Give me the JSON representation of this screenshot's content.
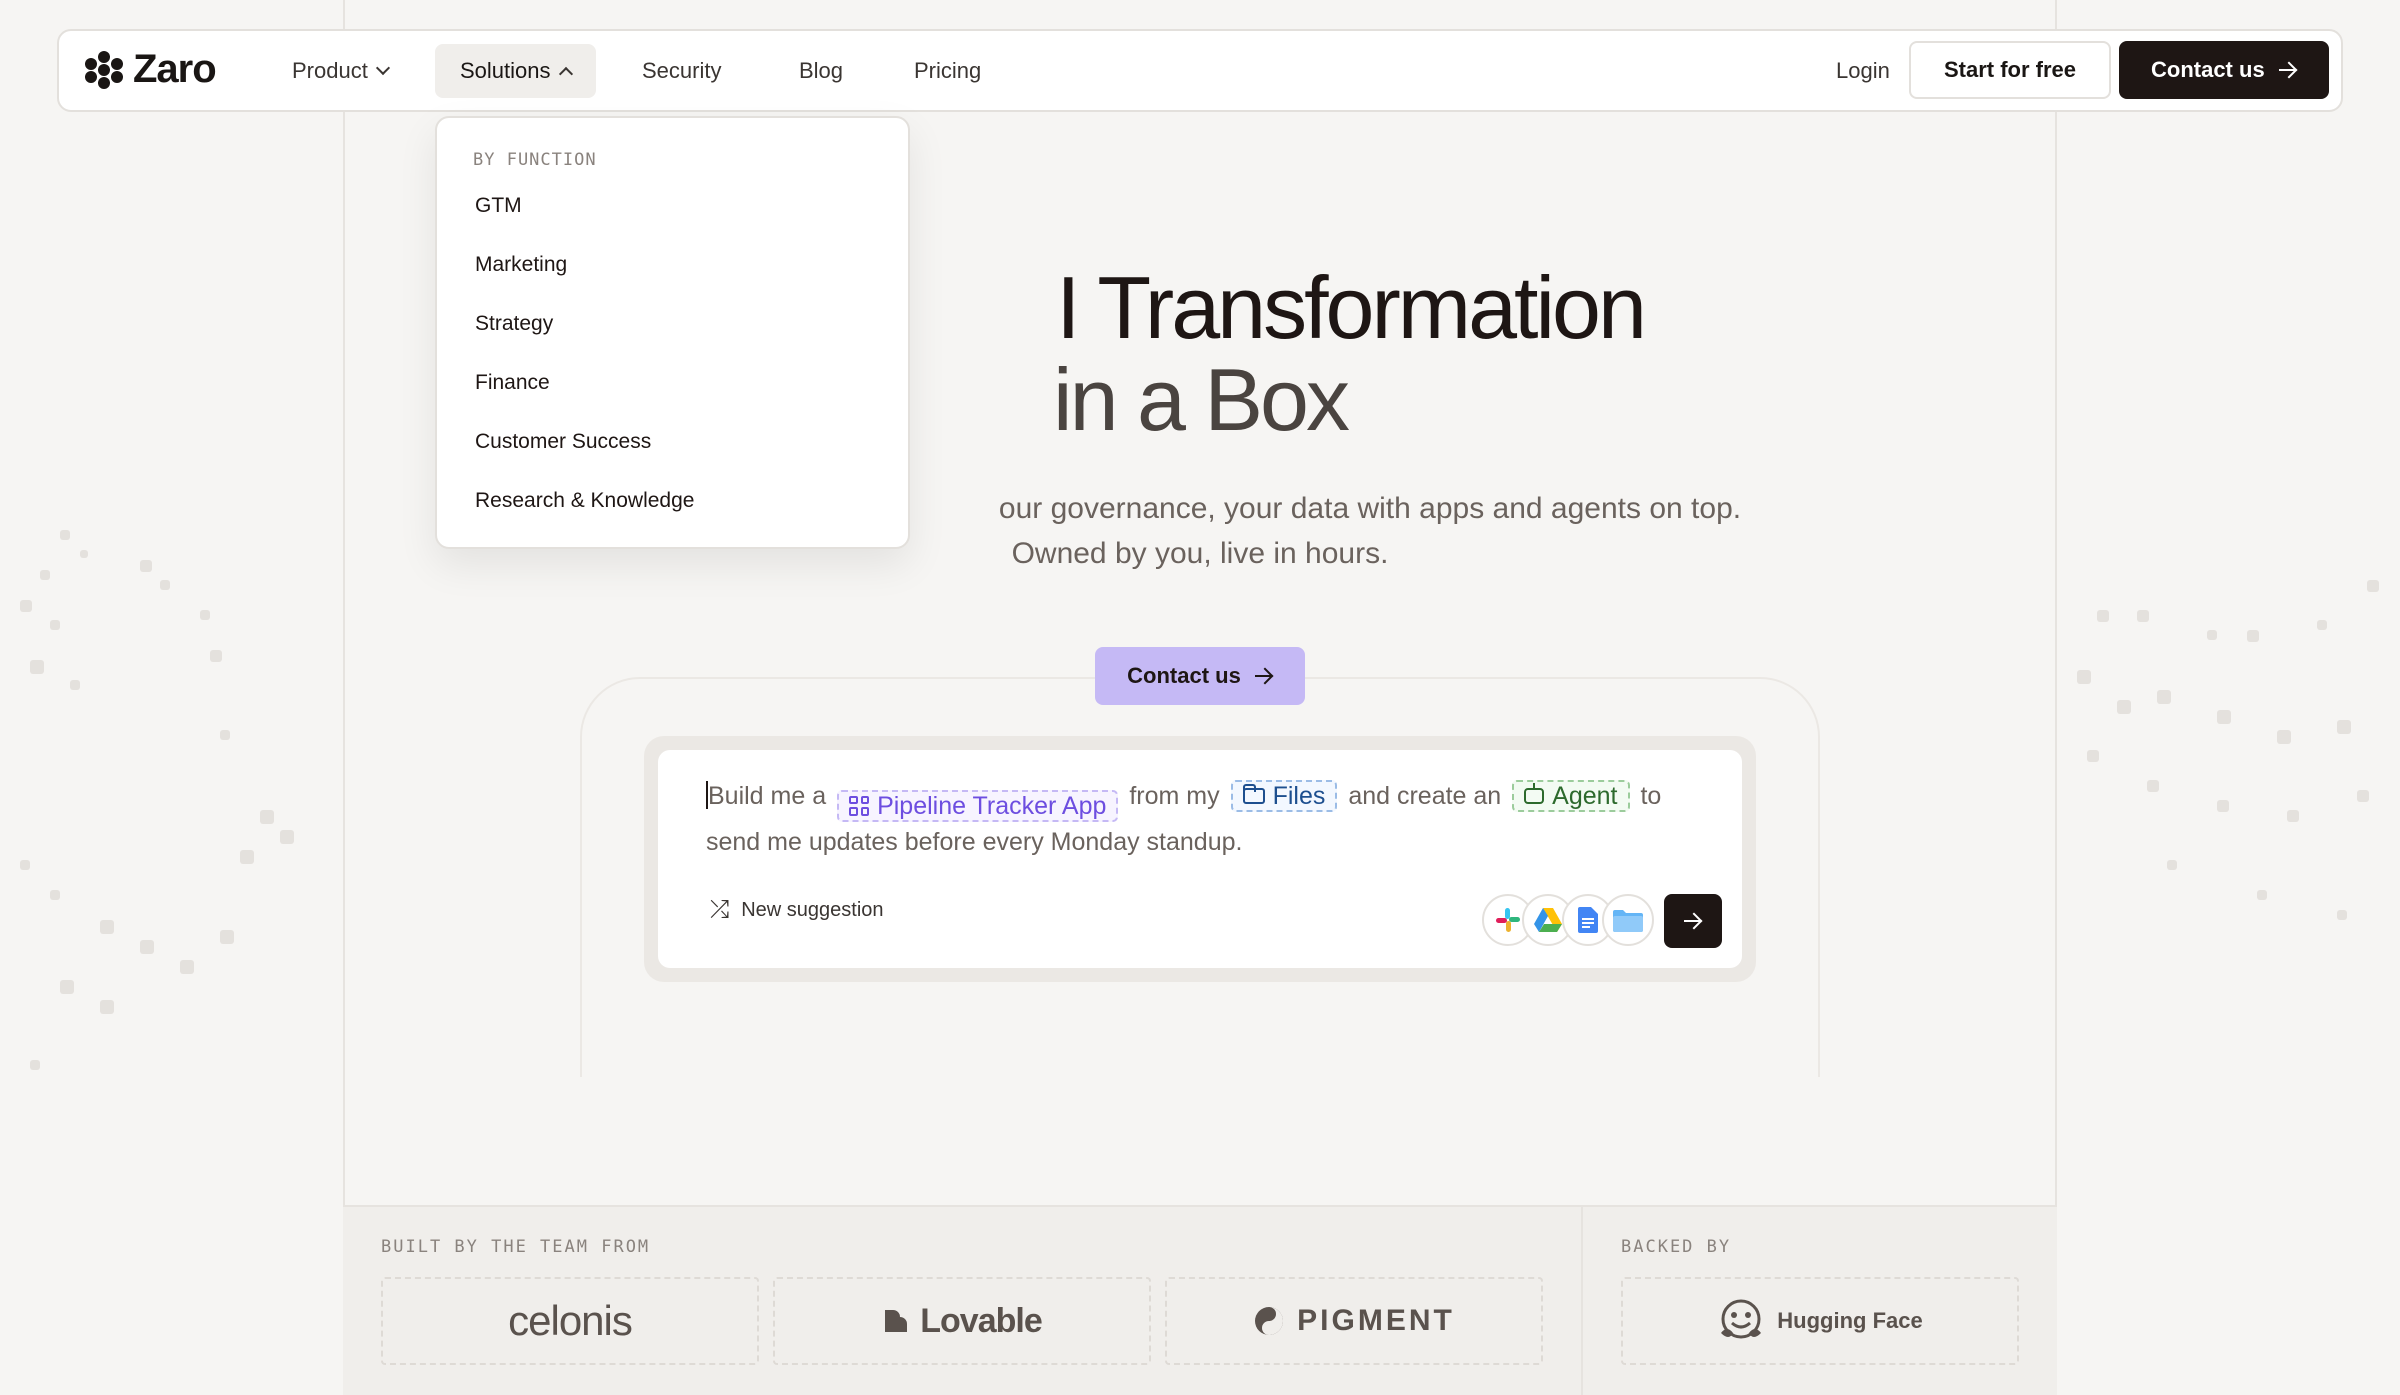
{
  "brand": {
    "name": "Zaro"
  },
  "nav": {
    "items": [
      {
        "label": "Product",
        "has_dropdown": true,
        "expanded": false
      },
      {
        "label": "Solutions",
        "has_dropdown": true,
        "expanded": true
      },
      {
        "label": "Security"
      },
      {
        "label": "Blog"
      },
      {
        "label": "Pricing"
      }
    ],
    "login": "Login",
    "start_free": "Start for free",
    "contact": "Contact us"
  },
  "dropdown": {
    "heading": "BY FUNCTION",
    "items": [
      "GTM",
      "Marketing",
      "Strategy",
      "Finance",
      "Customer Success",
      "Research & Knowledge"
    ]
  },
  "hero": {
    "title_line1": "I Transformation",
    "title_line2": "in a Box",
    "subtitle_line1": "our governance, your data with apps and agents on top.",
    "subtitle_line2": "Owned by you, live in hours.",
    "cta": "Contact us"
  },
  "prompt": {
    "part1": "Build me a",
    "chip_app": "Pipeline Tracker App",
    "part2": "from my",
    "chip_files": "Files",
    "part3": "and create an",
    "chip_agent": "Agent",
    "part4": "to send me updates before every Monday standup.",
    "new_suggestion": "New suggestion",
    "integrations": [
      "slack-icon",
      "google-drive-icon",
      "google-docs-icon",
      "folder-icon"
    ]
  },
  "footer_band": {
    "built_label": "BUILT BY THE TEAM FROM",
    "built_logos": [
      "celonis",
      "Lovable",
      "PIGMENT"
    ],
    "backed_label": "BACKED BY",
    "backed_logos": [
      "Hugging Face"
    ]
  },
  "colors": {
    "accent": "#c5b9f5",
    "dark": "#1e1614",
    "chip_purple": "#6d4ee0",
    "chip_blue": "#1d4f8f",
    "chip_green": "#2d6a2d"
  }
}
